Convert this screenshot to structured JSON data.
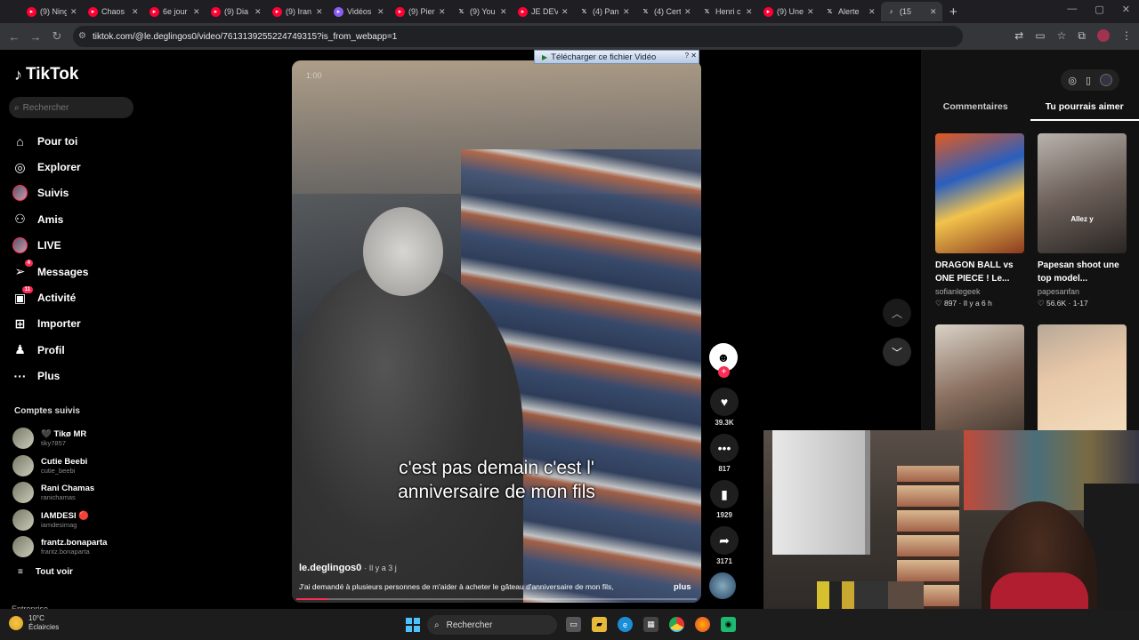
{
  "browser": {
    "tabs": [
      {
        "title": "(9) Ning",
        "icon": "youtube-icon",
        "color": "#ff0033"
      },
      {
        "title": "Chaos",
        "icon": "youtube-icon",
        "color": "#ff0033"
      },
      {
        "title": "6e jour",
        "icon": "youtube-icon",
        "color": "#ff0033"
      },
      {
        "title": "(9) Dia",
        "icon": "youtube-icon",
        "color": "#ff0033"
      },
      {
        "title": "(9) Iran",
        "icon": "youtube-icon",
        "color": "#ff0033"
      },
      {
        "title": "Vidéos",
        "icon": "video-icon",
        "color": "#8a5cf6"
      },
      {
        "title": "(9) Pier",
        "icon": "youtube-icon",
        "color": "#ff0033"
      },
      {
        "title": "(9) You",
        "icon": "x-icon",
        "color": "#ffffff"
      },
      {
        "title": "JE DEV",
        "icon": "youtube-icon",
        "color": "#ff0033"
      },
      {
        "title": "(4) Pan",
        "icon": "x-icon",
        "color": "#ffffff"
      },
      {
        "title": "(4) Cert",
        "icon": "x-icon",
        "color": "#ffffff"
      },
      {
        "title": "Henri c",
        "icon": "x-icon",
        "color": "#ffffff"
      },
      {
        "title": "(9) Une",
        "icon": "youtube-icon",
        "color": "#ff0033"
      },
      {
        "title": "Alerte",
        "icon": "x-icon",
        "color": "#ffffff"
      },
      {
        "title": "(15",
        "icon": "tiktok-icon",
        "color": "#ffffff"
      }
    ],
    "url": "tiktok.com/@le.deglingos0/video/7613139255224749315?is_from_webapp=1"
  },
  "download_bar": {
    "label": "Télécharger ce fichier Vidéo"
  },
  "sidebar": {
    "logo": "TikTok",
    "search_placeholder": "Rechercher",
    "nav": [
      {
        "label": "Pour toi",
        "icon": "home-icon"
      },
      {
        "label": "Explorer",
        "icon": "compass-icon"
      },
      {
        "label": "Suivis",
        "icon": "following-avatar-icon"
      },
      {
        "label": "Amis",
        "icon": "friends-icon"
      },
      {
        "label": "LIVE",
        "icon": "live-avatar-icon"
      },
      {
        "label": "Messages",
        "icon": "messages-icon",
        "badge": "4"
      },
      {
        "label": "Activité",
        "icon": "activity-icon",
        "badge": "11"
      },
      {
        "label": "Importer",
        "icon": "upload-icon"
      },
      {
        "label": "Profil",
        "icon": "profile-icon"
      },
      {
        "label": "Plus",
        "icon": "more-icon"
      }
    ],
    "followed_title": "Comptes suivis",
    "followed": [
      {
        "name": "🖤 Tikø MR",
        "handle": "tiky7857"
      },
      {
        "name": "Cutie Beebi",
        "handle": "cutie_beebi"
      },
      {
        "name": "Rani Chamas",
        "handle": "ranichamas"
      },
      {
        "name": "IAMDESI 🔴",
        "handle": "iamdesimag"
      },
      {
        "name": "frantz.bonaparta",
        "handle": "frantz.bonaparta"
      }
    ],
    "see_all": "Tout voir",
    "section_cut": "Entreprise"
  },
  "video": {
    "timecode": "1:00",
    "subtitle_line1": "c'est pas demain c'est l'",
    "subtitle_line2": "anniversaire de mon fils",
    "author": "le.deglingos0",
    "ago": "· Il y a 3 j",
    "caption": "J'ai demandé à plusieurs personnes de m'aider à acheter le gâteau d'anniversaire de mon fils,",
    "more": "plus",
    "progress": 0.08
  },
  "actions": {
    "likes": "39.3K",
    "comments": "817",
    "saves": "1929",
    "shares": "3171"
  },
  "right_panel": {
    "tabs": [
      "Commentaires",
      "Tu pourrais aimer"
    ],
    "active_tab": 1,
    "cards": [
      {
        "title": "DRAGON BALL vs ONE PIECE ! Le...",
        "user": "sofianlegeek",
        "meta": "♡ 897 · Il y a 6 h",
        "overlay": ""
      },
      {
        "title": "Papesan shoot une top model...",
        "user": "papesanfan",
        "meta": "♡ 56.6K · 1-17",
        "overlay": "Allez y"
      },
      {
        "title": "",
        "user": "",
        "meta": "",
        "overlay": ""
      },
      {
        "title": "",
        "user": "",
        "meta": "",
        "overlay": ""
      }
    ]
  },
  "taskbar": {
    "temperature": "10°C",
    "weather": "Éclaircies",
    "search": "Rechercher"
  },
  "colors": {
    "accent": "#fe2c55",
    "start": "#4cc2ff"
  }
}
